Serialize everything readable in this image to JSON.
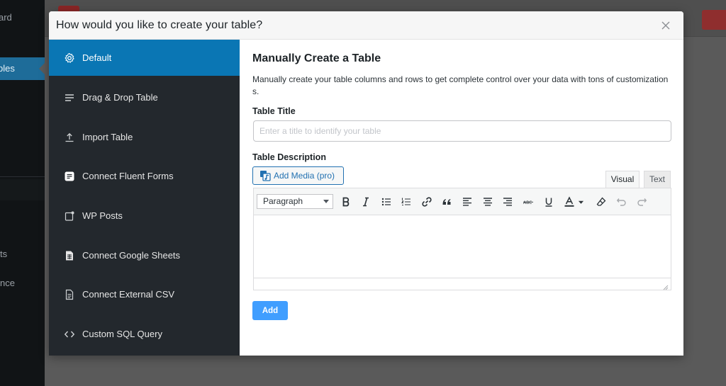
{
  "wp_sidebar": {
    "items": [
      {
        "label": "ard"
      },
      {
        "label": "bles"
      },
      {
        "label": "ts"
      },
      {
        "label": "nce"
      }
    ]
  },
  "modal": {
    "title": "How would you like to create your table?",
    "close_icon": "close-icon",
    "menu": [
      {
        "label": "Default",
        "icon": "gear-icon",
        "active": true
      },
      {
        "label": "Drag & Drop Table",
        "icon": "lines-icon"
      },
      {
        "label": "Import Table",
        "icon": "upload-icon"
      },
      {
        "label": "Connect Fluent Forms",
        "icon": "form-icon"
      },
      {
        "label": "WP Posts",
        "icon": "post-icon"
      },
      {
        "label": "Connect Google Sheets",
        "icon": "spreadsheet-icon"
      },
      {
        "label": "Connect External CSV",
        "icon": "document-icon"
      },
      {
        "label": "Custom SQL Query",
        "icon": "code-icon"
      }
    ],
    "panel": {
      "heading": "Manually Create a Table",
      "description": "Manually create your table columns and rows to get complete control over your data with tons of customizations.",
      "title_label": "Table Title",
      "title_placeholder": "Enter a title to identify your table",
      "title_value": "",
      "description_label": "Table Description",
      "add_media_label": "Add Media (pro)",
      "tabs": {
        "visual": "Visual",
        "text": "Text"
      },
      "format_select": "Paragraph",
      "add_button": "Add"
    }
  },
  "colors": {
    "menu_bg": "#23282d",
    "menu_active": "#0a76b4",
    "add_button": "#409eff",
    "wp_active": "#1e6c99"
  }
}
